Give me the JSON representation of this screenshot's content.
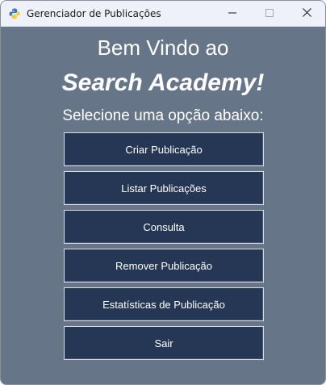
{
  "window": {
    "title": "Gerenciador de Publicações",
    "icon": "python-icon"
  },
  "titlebar_controls": {
    "minimize_icon": "minimize-icon",
    "maximize_icon": "maximize-icon",
    "close_icon": "close-icon"
  },
  "header": {
    "welcome": "Bem Vindo ao",
    "brand": "Search Academy!",
    "prompt": "Selecione uma opção abaixo:"
  },
  "menu": {
    "buttons": [
      {
        "label": "Criar Publicação"
      },
      {
        "label": "Listar Publicações"
      },
      {
        "label": "Consulta"
      },
      {
        "label": "Remover Publicação"
      },
      {
        "label": "Estatísticas de Publicação"
      },
      {
        "label": "Sair"
      }
    ]
  },
  "colors": {
    "background": "#677589",
    "button": "#253754",
    "button_text": "#ffffff",
    "titlebar": "#eef1f9"
  }
}
